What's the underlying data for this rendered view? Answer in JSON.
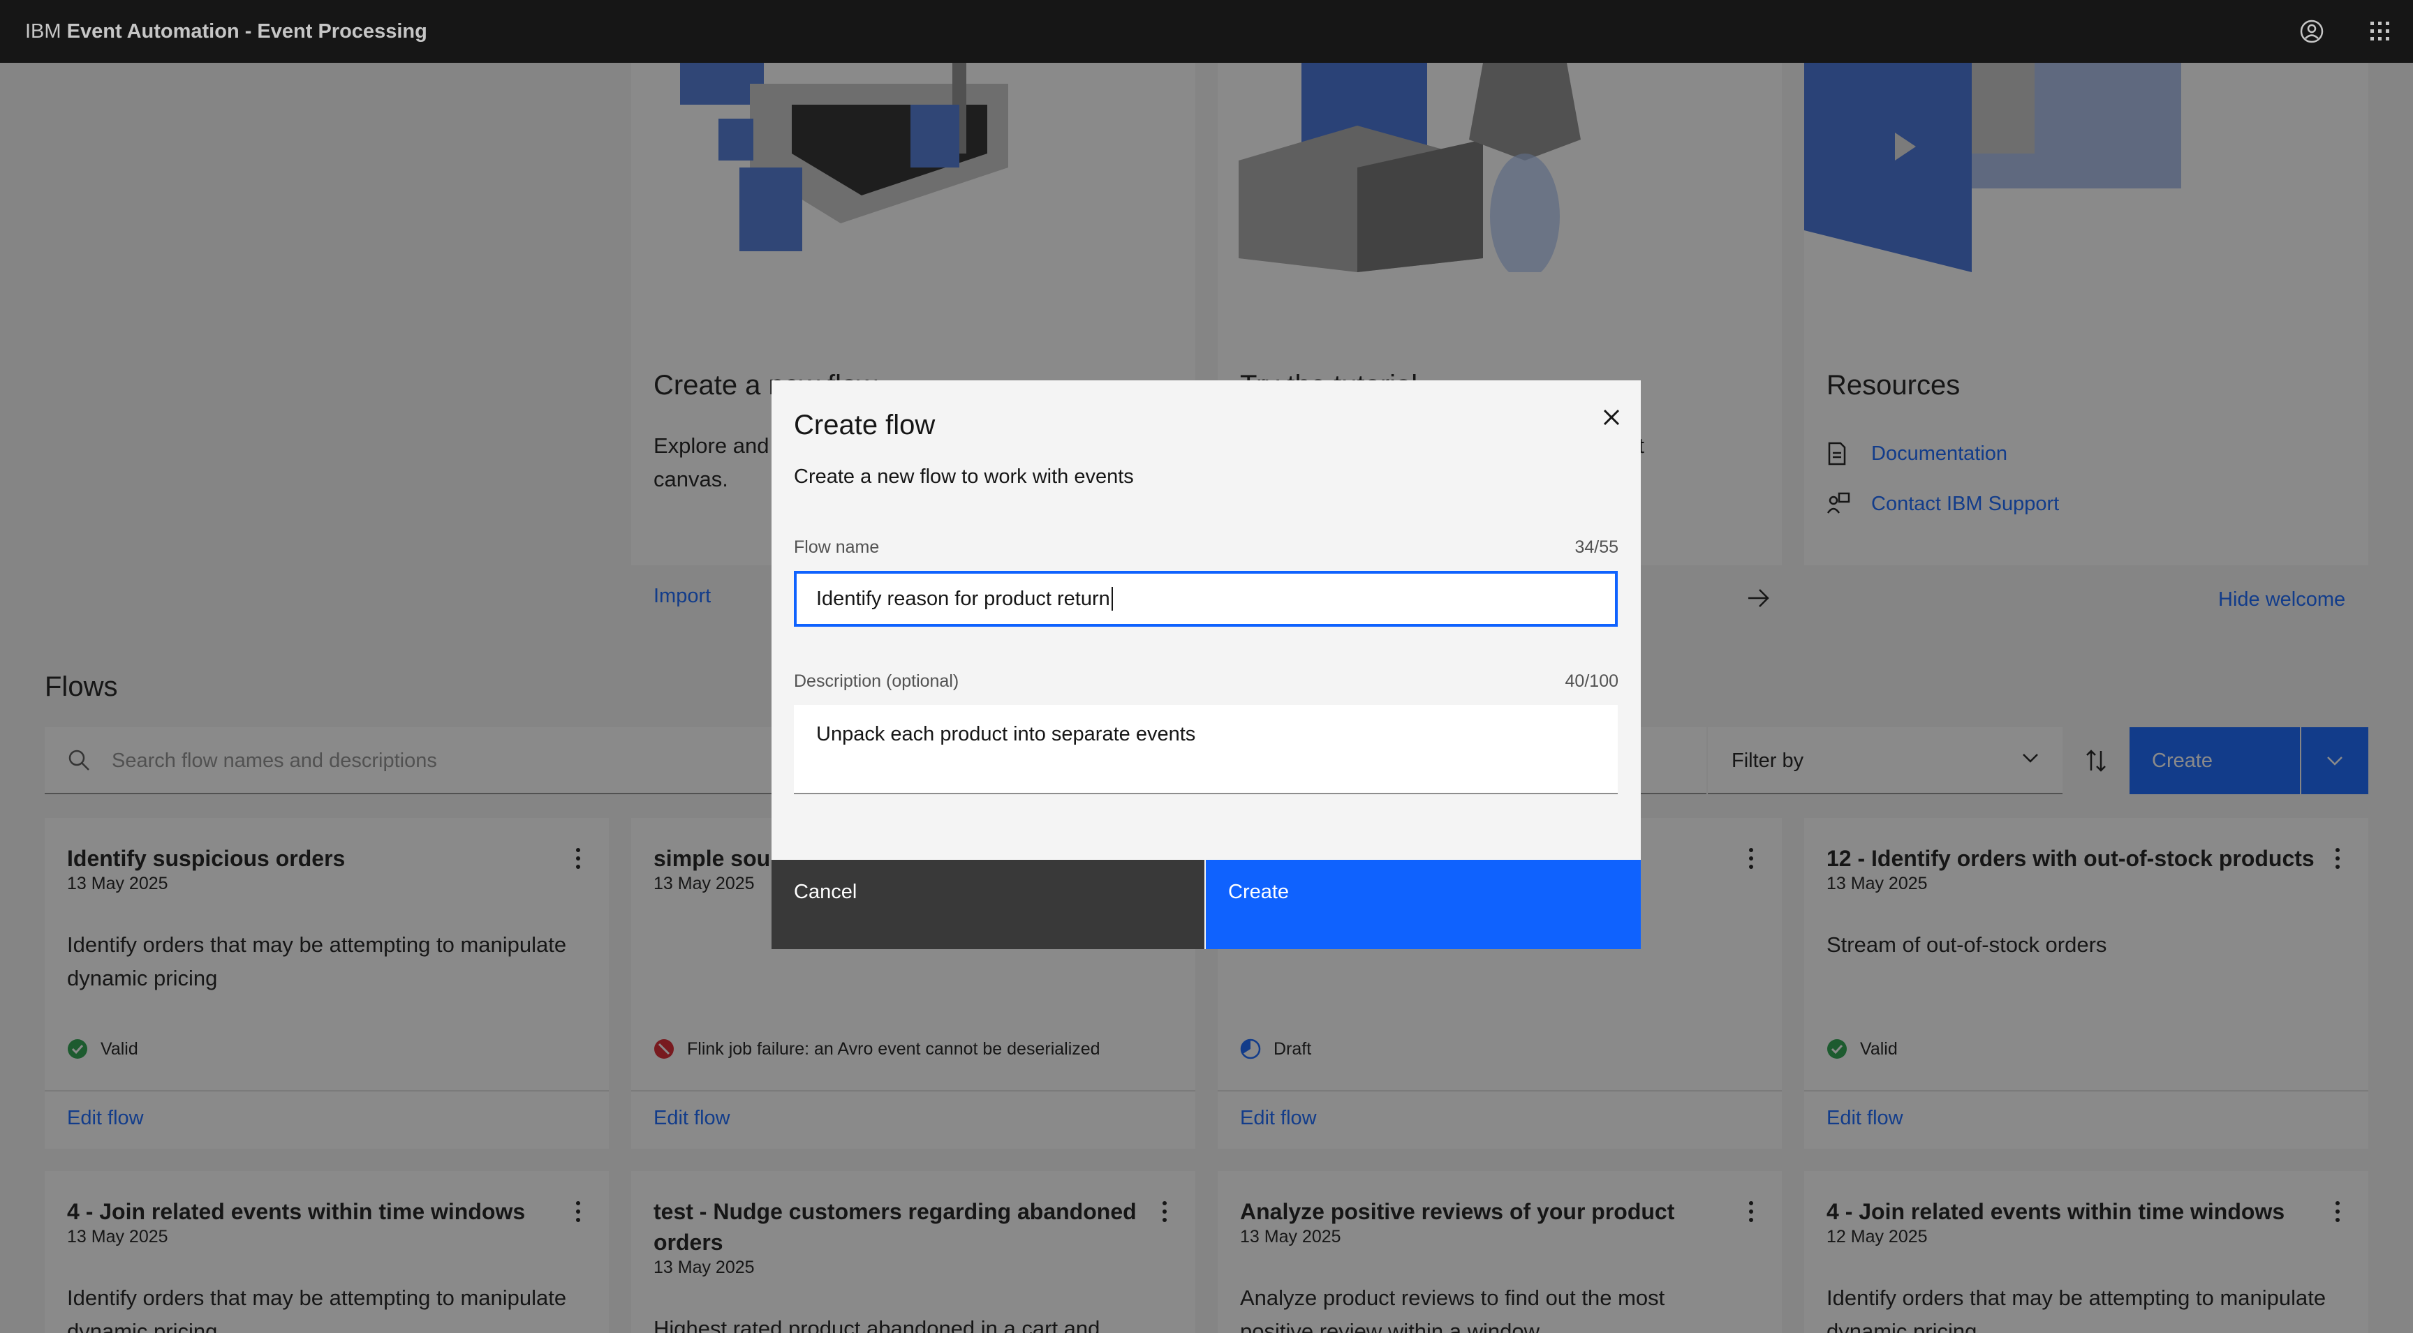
{
  "header": {
    "brand_prefix": "IBM",
    "brand_name": "Event Automation - Event Processing"
  },
  "welcome": {
    "tiles": [
      {
        "title": "Create a new flow",
        "description": "Explore and create an event stream in the authoring canvas.",
        "link": "Import"
      },
      {
        "title": "Try the tutorial",
        "description": "Learn concepts and get started with Event"
      },
      {
        "title": "Resources",
        "links": [
          "Documentation",
          "Contact IBM Support"
        ]
      }
    ],
    "hide_label": "Hide welcome"
  },
  "flows": {
    "title": "Flows",
    "search_placeholder": "Search flow names and descriptions",
    "filter_label": "Filter by",
    "create_label": "Create",
    "cards": [
      {
        "title": "Identify suspicious orders",
        "date": "13 May 2025",
        "description": "Identify orders that may be attempting to manipulate dynamic pricing",
        "status": "Valid",
        "edit": "Edit flow"
      },
      {
        "title": "simple sour",
        "date": "13 May 2025",
        "description": "",
        "status": "Flink job failure: an Avro event cannot be deserialized",
        "edit": "Edit flow"
      },
      {
        "title": "",
        "date": "",
        "description": "",
        "status": "Draft",
        "edit": "Edit flow"
      },
      {
        "title": "12 - Identify orders with out-of-stock products",
        "date": "13 May 2025",
        "description": "Stream of out-of-stock orders",
        "status": "Valid",
        "edit": "Edit flow"
      },
      {
        "title": "4 - Join related events within time windows",
        "date": "13 May 2025",
        "description": "Identify orders that may be attempting to manipulate dynamic pricing"
      },
      {
        "title": "test - Nudge customers regarding abandoned orders",
        "date": "13 May 2025",
        "description": "Highest rated product abandoned in a cart and"
      },
      {
        "title": "Analyze positive reviews of your product",
        "date": "13 May 2025",
        "description": "Analyze product reviews to find out the most positive review within a window"
      },
      {
        "title": "4 - Join related events within time windows",
        "date": "12 May 2025",
        "description": "Identify orders that may be attempting to manipulate dynamic pricing"
      }
    ]
  },
  "modal": {
    "title": "Create flow",
    "subtitle": "Create a new flow to work with events",
    "name_label": "Flow name",
    "name_count": "34/55",
    "name_value": "Identify reason for product return",
    "desc_label": "Description (optional)",
    "desc_count": "40/100",
    "desc_value": "Unpack each product into separate events",
    "cancel_label": "Cancel",
    "create_label": "Create"
  },
  "colors": {
    "primary": "#0f62fe",
    "header_bg": "#161616",
    "valid": "#24a148",
    "error": "#da1e28",
    "draft": "#0f62fe"
  }
}
